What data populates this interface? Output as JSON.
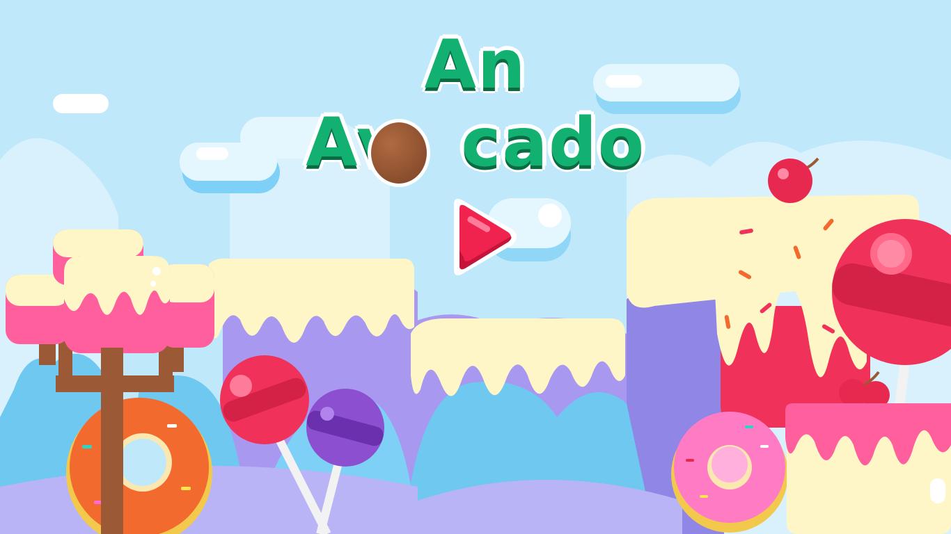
{
  "game": {
    "title_line1": "An",
    "title_line2_part1": "Av",
    "title_line2_part2": "cado",
    "title_o_icon": "avocado-pit-icon",
    "play_icon": "play-icon"
  },
  "colors": {
    "sky": "#bfe9fb",
    "title_green": "#12b172",
    "title_shadow": "#0a6b43",
    "play_red": "#f0224e",
    "cloud_white": "#ffffff",
    "cream": "#fff6c8",
    "candy_pink": "#ff5f9c",
    "lollipop_red": "#f0325a",
    "lollipop_purple": "#8b4fcf",
    "donut_orange": "#f26a2e",
    "donut_pink": "#ff7cc4",
    "hill_blue": "#6fc8f0",
    "hill_purple": "#a898ef"
  }
}
